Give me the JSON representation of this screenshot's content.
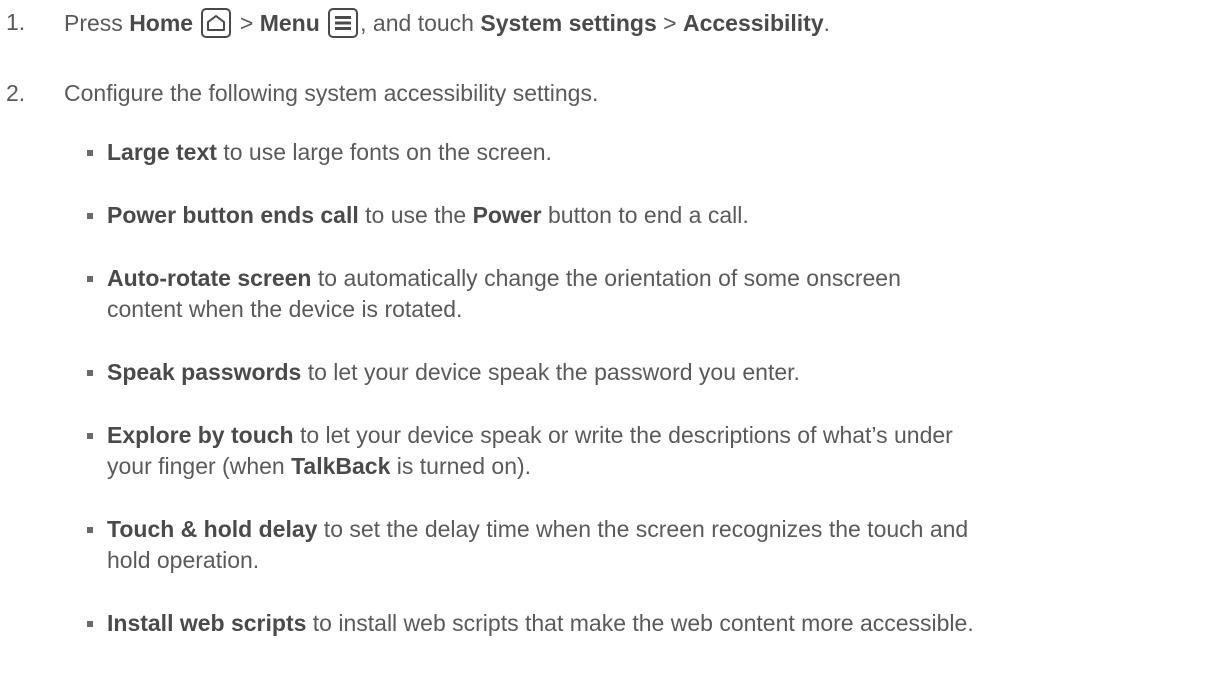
{
  "steps": [
    {
      "number": "1.",
      "parts": [
        "Press ",
        "Home",
        " > ",
        "Menu",
        ", and touch ",
        "System settings",
        " > ",
        "Accessibility",
        "."
      ],
      "icons": [
        "home-icon",
        "menu-icon"
      ]
    },
    {
      "number": "2.",
      "text": "Configure the following system accessibility settings."
    }
  ],
  "settings": [
    {
      "name": "Large text",
      "desc": " to use large fonts on the screen."
    },
    {
      "name": "Power button ends call",
      "desc1": " to use the ",
      "bold2": "Power",
      "desc2": " button to end a call."
    },
    {
      "name": "Auto-rotate screen",
      "desc": " to automatically change the orientation of some onscreen",
      "desc_cont": "content when the device is rotated."
    },
    {
      "name": "Speak passwords",
      "desc": " to let your device speak the password you enter."
    },
    {
      "name": "Explore by touch",
      "desc": " to let your device speak or write the descriptions of what’s under",
      "cont1": "your finger (when ",
      "bold2": "TalkBack",
      "cont2": " is turned on)."
    },
    {
      "name": "Touch & hold delay",
      "desc": " to set the delay time when the screen recognizes the touch and",
      "desc_cont": "hold operation."
    },
    {
      "name": "Install web scripts",
      "desc": " to install web scripts that make the web content more accessible."
    }
  ]
}
